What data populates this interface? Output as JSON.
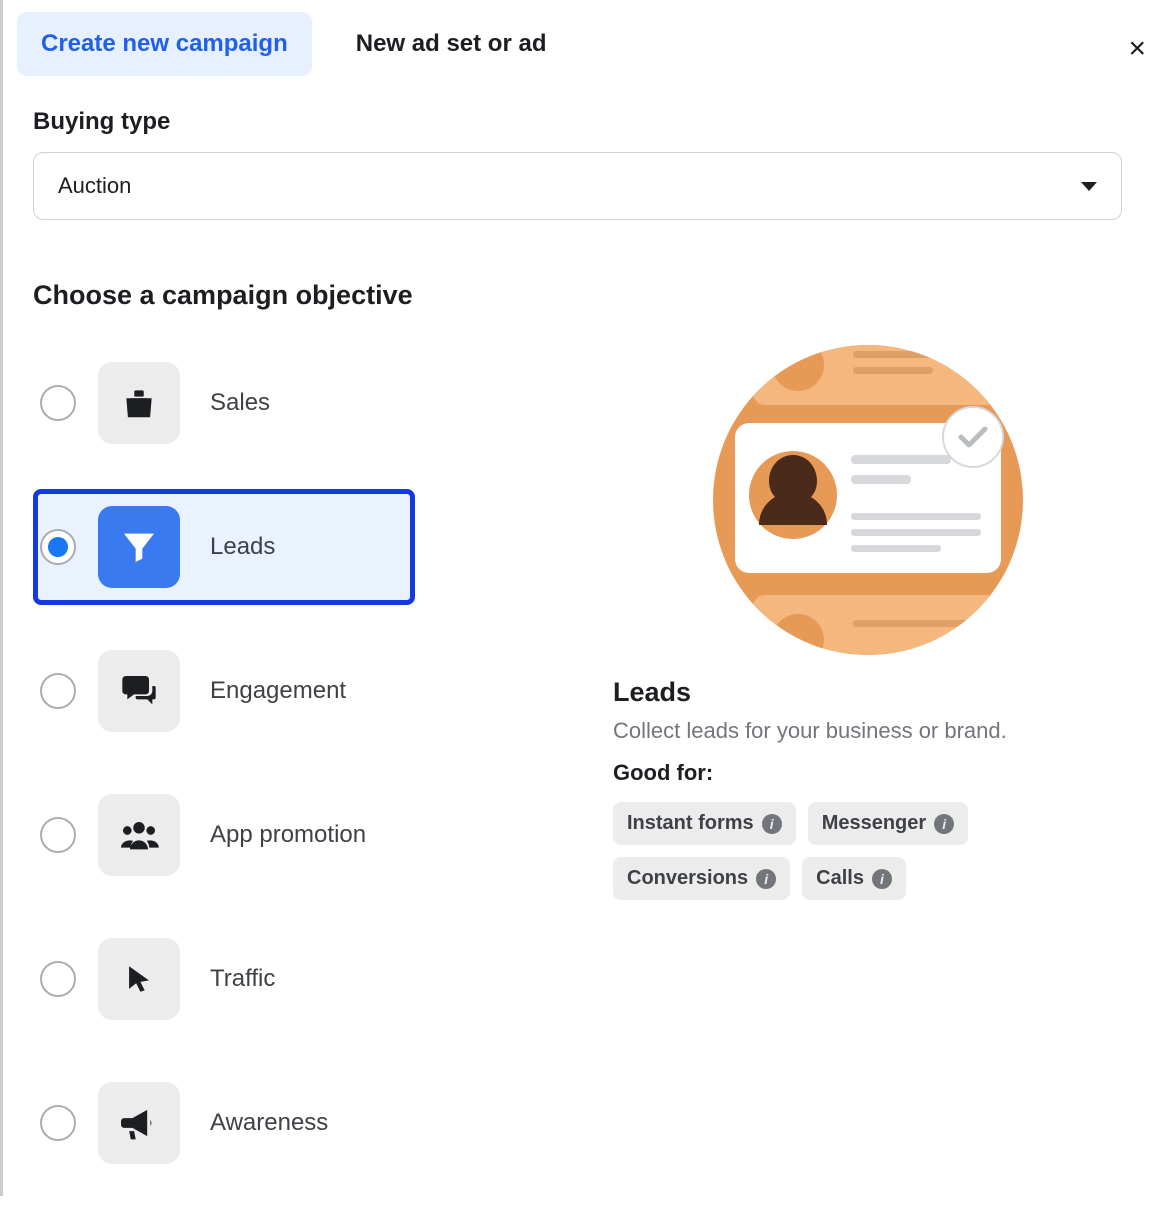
{
  "tabs": {
    "create": "Create new campaign",
    "new_adset": "New ad set or ad",
    "active_index": 0
  },
  "close_symbol": "×",
  "buying_type": {
    "label": "Buying type",
    "value": "Auction"
  },
  "objectives": {
    "heading": "Choose a campaign objective",
    "selected_index": 1,
    "items": [
      {
        "label": "Sales",
        "icon": "bag-icon"
      },
      {
        "label": "Leads",
        "icon": "funnel-icon"
      },
      {
        "label": "Engagement",
        "icon": "chat-icon"
      },
      {
        "label": "App promotion",
        "icon": "group-icon"
      },
      {
        "label": "Traffic",
        "icon": "cursor-icon"
      },
      {
        "label": "Awareness",
        "icon": "megaphone-icon"
      }
    ]
  },
  "detail": {
    "title": "Leads",
    "subtitle": "Collect leads for your business or brand.",
    "good_for_label": "Good for:",
    "chips": [
      "Instant forms",
      "Messenger",
      "Conversions",
      "Calls"
    ]
  }
}
